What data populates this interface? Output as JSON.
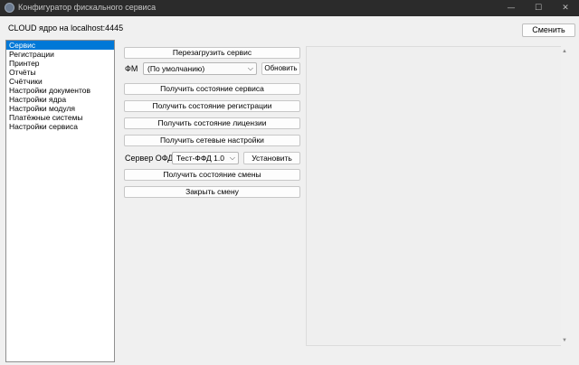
{
  "window": {
    "title": "Конфигуратор фискального сервиса",
    "minimize_glyph": "—",
    "maximize_glyph": "☐",
    "close_glyph": "✕"
  },
  "header": {
    "host_label": "CLOUD ядро на localhost:4445",
    "change_button": "Сменить"
  },
  "sidebar": {
    "items": [
      {
        "label": "Сервис",
        "selected": true
      },
      {
        "label": "Регистрации"
      },
      {
        "label": "Принтер"
      },
      {
        "label": "Отчёты"
      },
      {
        "label": "Счётчики"
      },
      {
        "label": "Настройки документов"
      },
      {
        "label": "Настройки ядра"
      },
      {
        "label": "Настройки модуля"
      },
      {
        "label": "Платёжные системы"
      },
      {
        "label": "Настройки сервиса"
      }
    ]
  },
  "actions": {
    "restart_service": "Перезагрузить сервис",
    "fm_label": "ФМ",
    "fm_selected": "(По умолчанию)",
    "refresh": "Обновить",
    "get_service_state": "Получить состояние сервиса",
    "get_registration_state": "Получить состояние регистрации",
    "get_license_state": "Получить состояние лицензии",
    "get_network_settings": "Получить сетевые настройки",
    "ofd_label": "Сервер ОФД",
    "ofd_selected": "Тест-ФФД 1.0",
    "install": "Установить",
    "get_shift_state": "Получить состояние смены",
    "close_shift": "Закрыть смену"
  },
  "colors": {
    "selection": "#0078d7",
    "titlebar": "#2b2b2b"
  }
}
